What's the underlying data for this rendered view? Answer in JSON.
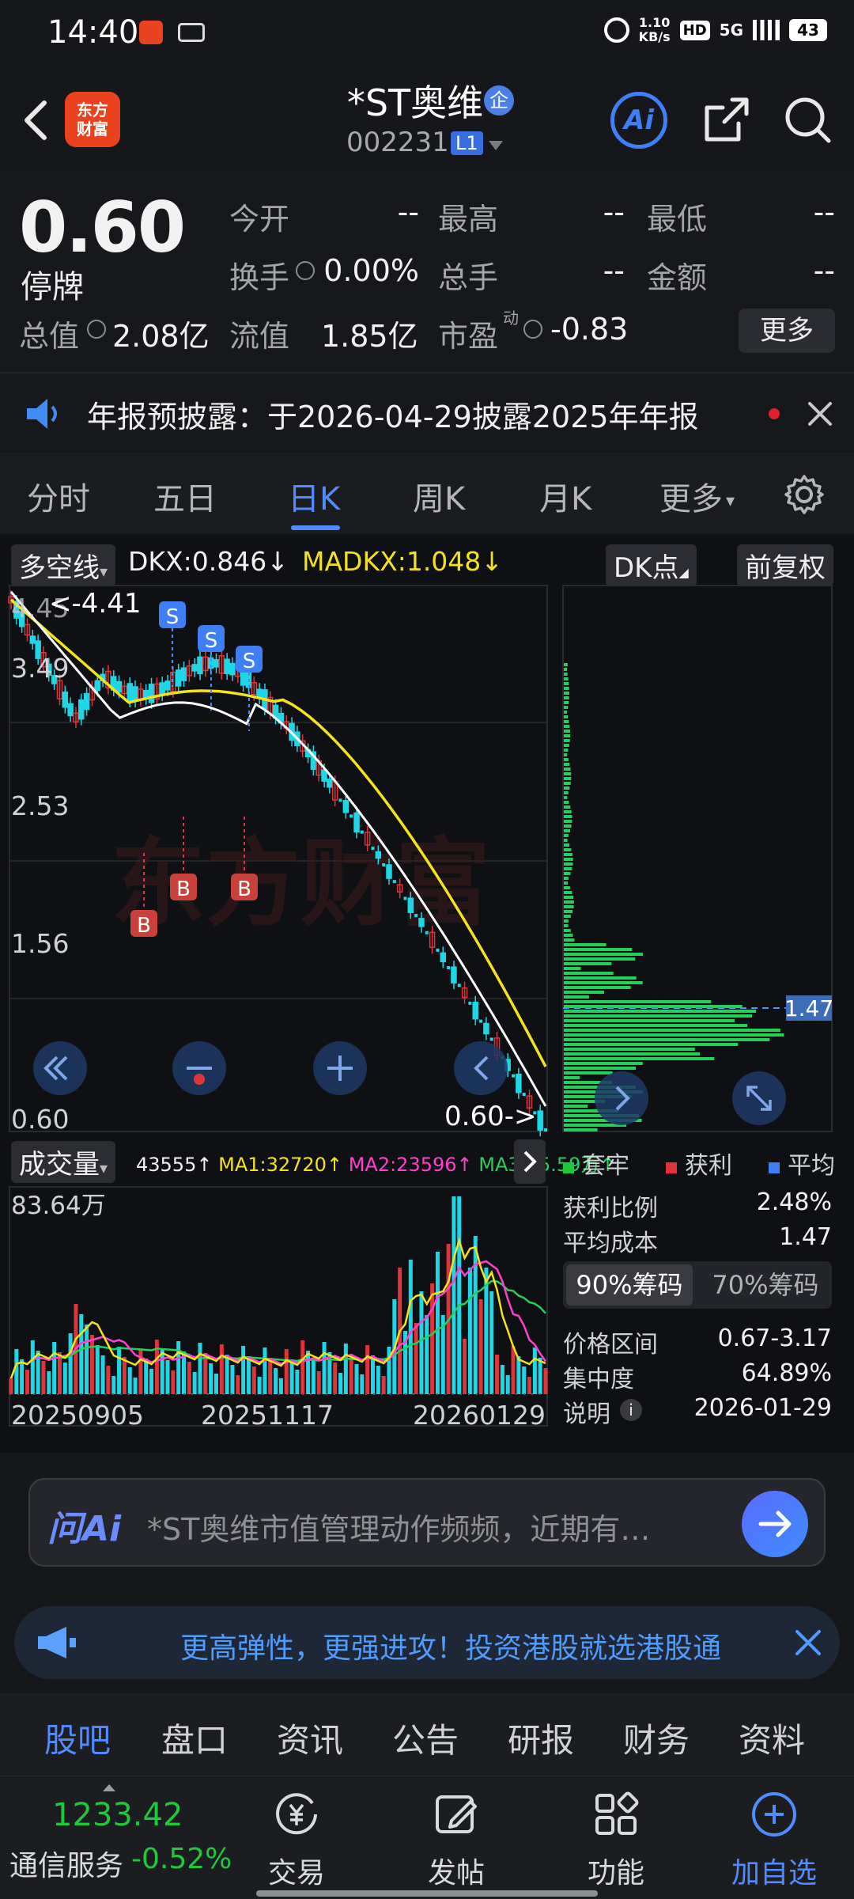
{
  "status_bar": {
    "time": "14:40",
    "net_speed_top": "1.10",
    "net_speed_bottom": "KB/s",
    "hd": "HD",
    "signal": "5G",
    "battery": "43"
  },
  "header": {
    "logo_line1": "东方",
    "logo_line2": "财富",
    "stock_name": "*ST奥维",
    "enterprise_badge": "企",
    "stock_code": "002231",
    "level_badge": "L1",
    "ai_label": "Ai"
  },
  "quote": {
    "price": "0.60",
    "status": "停牌",
    "open_label": "今开",
    "open_value": "--",
    "high_label": "最高",
    "high_value": "--",
    "low_label": "最低",
    "low_value": "--",
    "turnover_label": "换手",
    "turnover_value": "0.00%",
    "volume_label": "总手",
    "volume_value": "--",
    "amount_label": "金额",
    "amount_value": "--",
    "mktcap_label": "总值",
    "mktcap_value": "2.08亿",
    "float_label": "流值",
    "float_value": "1.85亿",
    "pe_label": "市盈",
    "pe_sup": "动",
    "pe_value": "-0.83",
    "more_button": "更多"
  },
  "notice": {
    "text": "年报预披露：于2026-04-29披露2025年年报"
  },
  "tabs": [
    "分时",
    "五日",
    "日K",
    "周K",
    "月K",
    "更多"
  ],
  "active_tab": "日K",
  "chart": {
    "indicator_selector": "多空线",
    "dkx_label": "DKX:0.846↓",
    "madkx_label": "MADKX:1.048↓",
    "dk_point_button": "DK点",
    "adjust_button": "前复权",
    "y_ticks": [
      "4.45",
      "3.49",
      "2.53",
      "1.56",
      "0.60"
    ],
    "high_annotation": "<-4.41",
    "last_annotation": "0.60->",
    "watermark": "东方财富",
    "signals": {
      "sell": "S",
      "buy": "B"
    },
    "cost_line_value": "1.47",
    "volume_selector": "成交量",
    "volume_values": {
      "vol": "43555↑",
      "ma1": "MA1:32720↑",
      "ma2": "MA2:23596↑",
      "ma3": "MA3:15.59万↑"
    },
    "volume_max": "83.64万",
    "x_dates": [
      "20250905",
      "20251117",
      "20260129"
    ],
    "colors": {
      "up": "#e0343b",
      "down": "#1fd6e6",
      "dkx": "#ffffff",
      "madkx": "#f4e21b",
      "ma1": "#f4e21b",
      "ma2": "#ff3fd0",
      "ma3": "#25d05a"
    }
  },
  "chip_panel": {
    "legend": [
      "套牢",
      "获利",
      "平均"
    ],
    "profit_ratio_label": "获利比例",
    "profit_ratio_value": "2.48%",
    "avg_cost_label": "平均成本",
    "avg_cost_value": "1.47",
    "tab_90": "90%筹码",
    "tab_70": "70%筹码",
    "price_range_label": "价格区间",
    "price_range_value": "0.67-3.17",
    "concentration_label": "集中度",
    "concentration_value": "64.89%",
    "note_label": "说明",
    "note_value": "2026-01-29"
  },
  "ai_bar": {
    "brand": "问Ai",
    "text": "*ST奥维市值管理动作频频，近期有…"
  },
  "banner": {
    "text": "更高弹性，更强进攻！投资港股就选港股通"
  },
  "bottom_tabs": [
    "股吧",
    "盘口",
    "资讯",
    "公告",
    "研报",
    "财务",
    "资料"
  ],
  "bottom_bar": {
    "index_value": "1233.42",
    "index_name": "通信服务",
    "index_change": "-0.52%",
    "items": [
      "交易",
      "发帖",
      "功能",
      "加自选"
    ]
  }
}
